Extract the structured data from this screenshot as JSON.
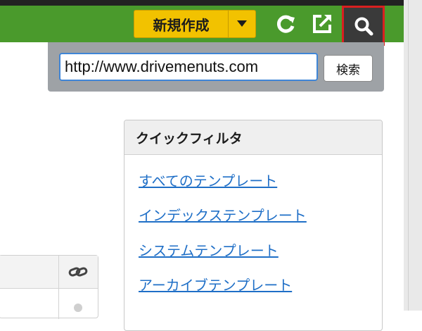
{
  "toolbar": {
    "new_button_label": "新規作成",
    "colors": {
      "green_bar": "#4a9a2c",
      "new_button": "#f2c200",
      "highlight": "#d92020"
    },
    "icons": [
      "caret-down-icon",
      "refresh-icon",
      "external-link-icon",
      "search-icon"
    ]
  },
  "search": {
    "value": "http://www.drivemenuts.com",
    "submit_label": "検索"
  },
  "quick_filter": {
    "title": "クイックフィルタ",
    "items": [
      {
        "label": "すべてのテンプレート"
      },
      {
        "label": "インデックステンプレート"
      },
      {
        "label": "システムテンプレート"
      },
      {
        "label": "アーカイブテンプレート"
      }
    ]
  },
  "left_table": {
    "header_icon": "link-icon"
  }
}
